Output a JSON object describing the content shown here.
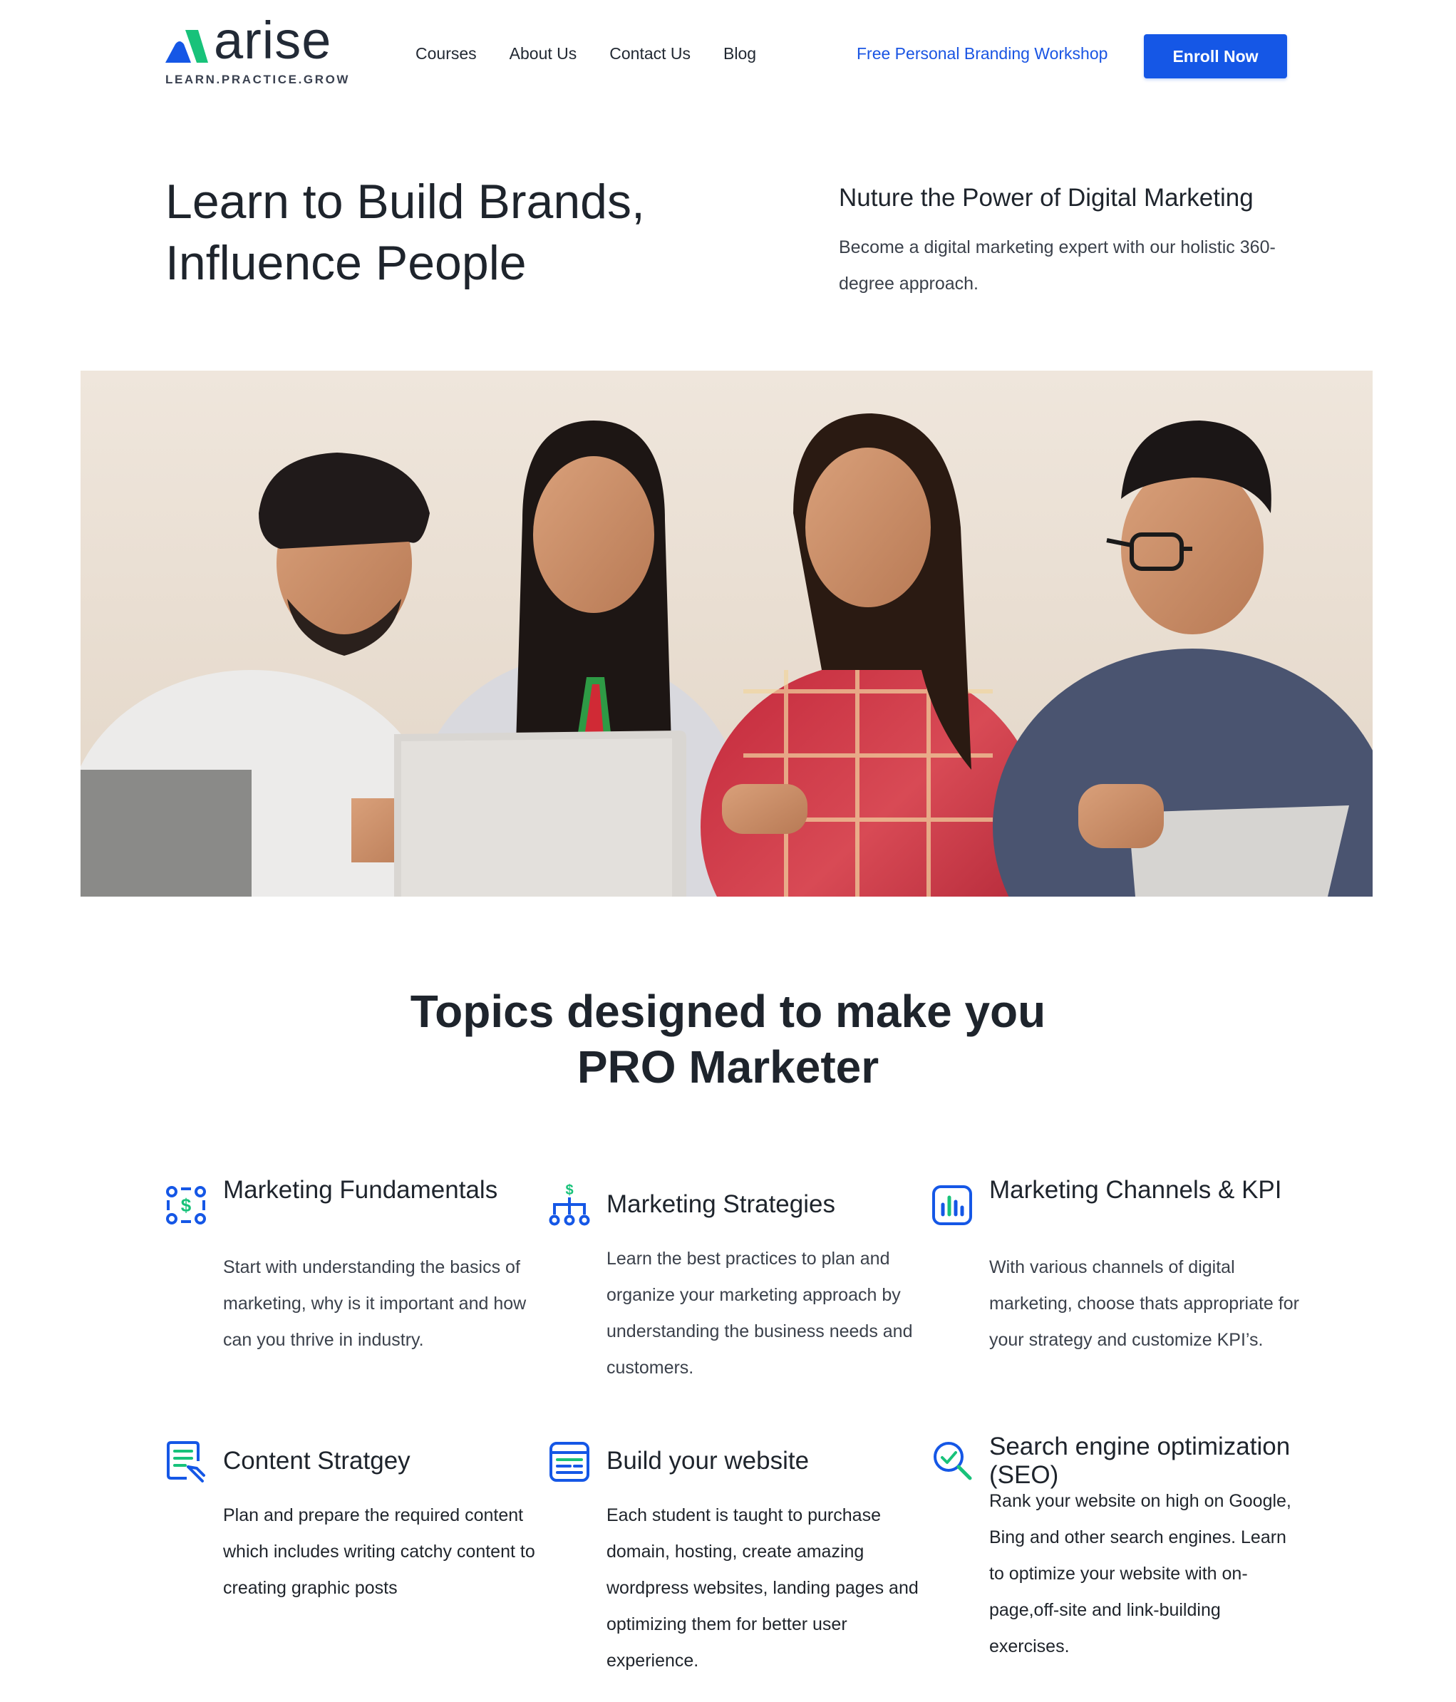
{
  "brand": {
    "name": "arise",
    "tagline": "LEARN.PRACTICE.GROW",
    "accent_color": "#1557e6",
    "logo_green": "#18c27a"
  },
  "nav": {
    "items": [
      {
        "label": "Courses"
      },
      {
        "label": "About Us"
      },
      {
        "label": "Contact Us"
      },
      {
        "label": "Blog"
      }
    ],
    "workshop_link": "Free Personal Branding Workshop",
    "enroll_button": "Enroll Now"
  },
  "hero": {
    "title_line1": "Learn to Build Brands,",
    "title_line2": "Influence People",
    "subtitle": "Nuture the Power of Digital Marketing",
    "description": "Become a digital marketing expert with our holistic 360-degree approach."
  },
  "topics": {
    "heading_line1": "Topics designed to make you",
    "heading_line2": "PRO Marketer",
    "items": [
      {
        "icon": "money-network-icon",
        "title": "Marketing Fundamentals",
        "description": "Start with understanding the basics of marketing, why is it important and how can you thrive in industry."
      },
      {
        "icon": "strategy-tree-icon",
        "title": "Marketing Strategies",
        "description": "Learn the best practices to plan and organize your marketing approach by understanding the business needs and customers."
      },
      {
        "icon": "bar-chart-icon",
        "title": "Marketing Channels & KPI",
        "description": "With various channels of digital marketing, choose thats appropriate for your strategy and customize KPI’s."
      },
      {
        "icon": "content-edit-icon",
        "title": "Content Stratgey",
        "description": "Plan and prepare the required content which includes writing catchy content to creating graphic posts"
      },
      {
        "icon": "website-layout-icon",
        "title": "Build your website",
        "description": "Each student is taught to purchase domain, hosting, create amazing wordpress websites, landing pages and optimizing them for better user experience."
      },
      {
        "icon": "search-check-icon",
        "title": "Search engine optimization (SEO)",
        "description": "Rank your website on high on Google, Bing and other search engines. Learn to optimize your website with on-page,off-site and link-building exercises."
      }
    ]
  }
}
